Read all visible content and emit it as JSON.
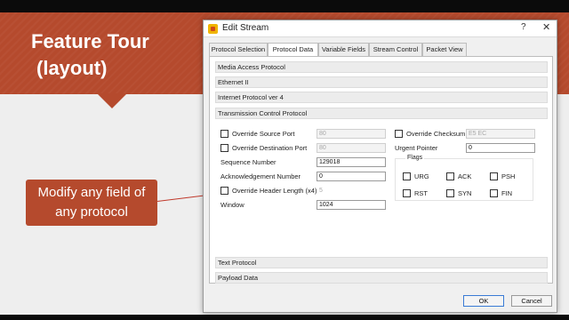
{
  "slide": {
    "title_line1": "Feature Tour",
    "title_line2": "(layout)",
    "callout": "Modify any field of any protocol",
    "accent_color": "#b54a2d"
  },
  "dialog": {
    "title": "Edit Stream",
    "help_glyph": "?",
    "close_glyph": "✕",
    "tabs": [
      {
        "label": "Protocol Selection"
      },
      {
        "label": "Protocol Data",
        "active": true
      },
      {
        "label": "Variable Fields"
      },
      {
        "label": "Stream Control"
      },
      {
        "label": "Packet View"
      }
    ],
    "sections_top": [
      "Media Access Protocol",
      "Ethernet II",
      "Internet Protocol ver 4",
      "Transmission Control Protocol"
    ],
    "sections_bottom": [
      "Text Protocol",
      "Payload Data"
    ],
    "tcp": {
      "override_source_port": {
        "label": "Override Source Port",
        "value": "80"
      },
      "override_dest_port": {
        "label": "Override Destination Port",
        "value": "80"
      },
      "sequence_number": {
        "label": "Sequence Number",
        "value": "129018"
      },
      "ack_number": {
        "label": "Acknowledgement Number",
        "value": "0"
      },
      "override_header_length": {
        "label": "Override Header Length (x4)",
        "value": "5"
      },
      "window": {
        "label": "Window",
        "value": "1024"
      },
      "override_checksum": {
        "label": "Override Checksum",
        "value": "E5 EC"
      },
      "urgent_pointer": {
        "label": "Urgent Pointer",
        "value": "0"
      },
      "flags_title": "Flags",
      "flags": [
        "URG",
        "ACK",
        "PSH",
        "RST",
        "SYN",
        "FIN"
      ]
    },
    "ok_label": "OK",
    "cancel_label": "Cancel"
  }
}
